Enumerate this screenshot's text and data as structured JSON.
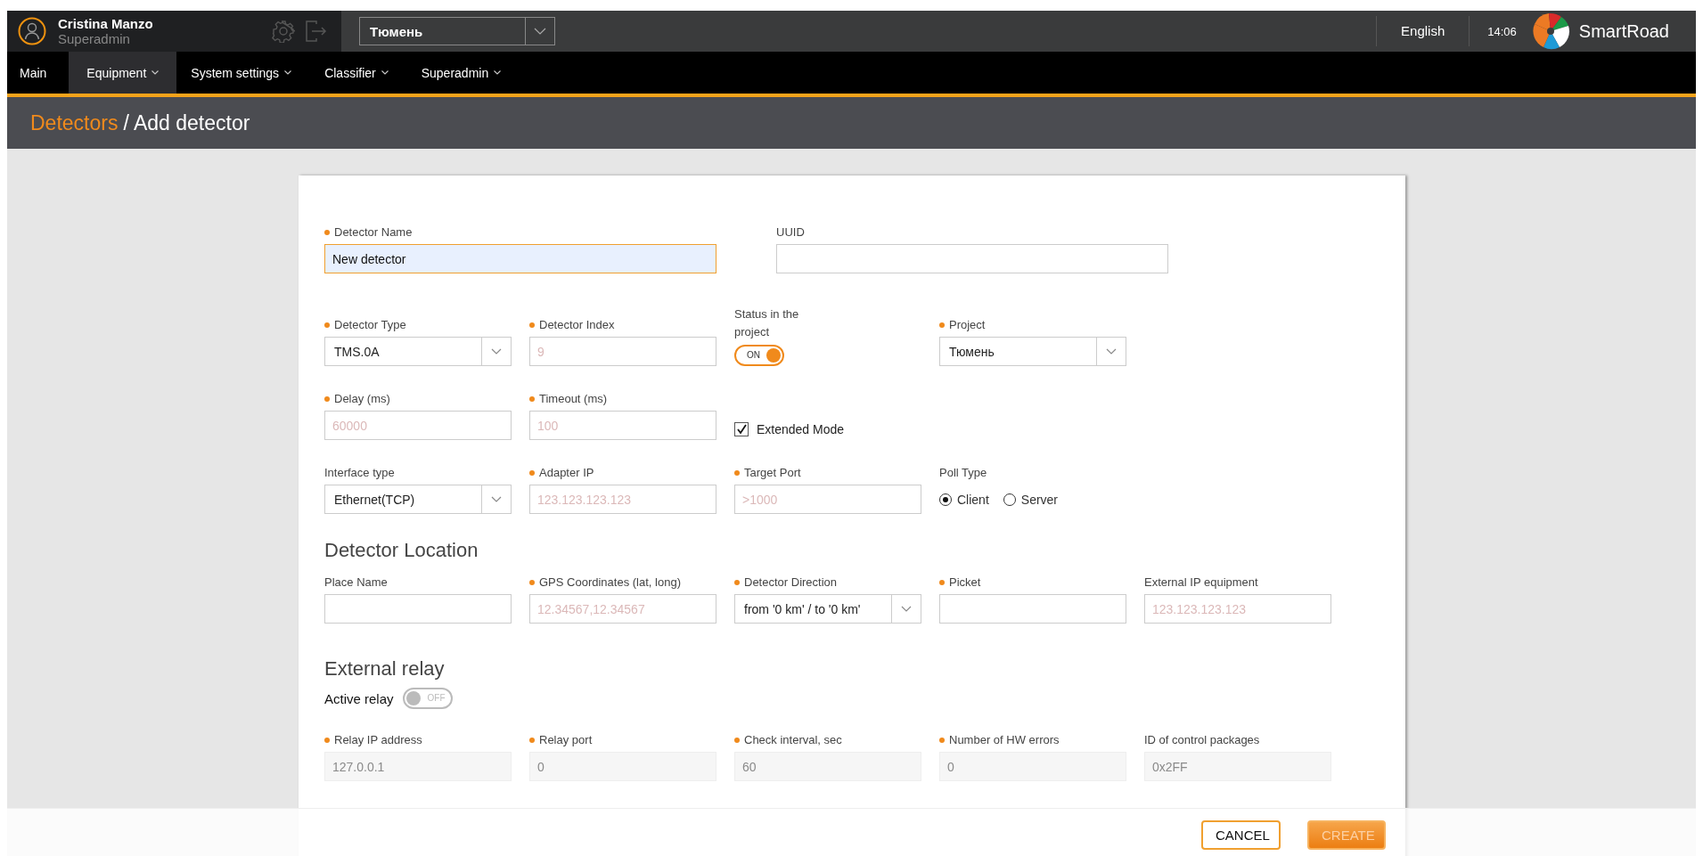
{
  "user": {
    "name": "Cristina Manzo",
    "role": "Superadmin"
  },
  "project_select": {
    "value": "Тюмень"
  },
  "language": "English",
  "time": "14:06",
  "brand": "SmartRoad",
  "nav": [
    {
      "label": "Main",
      "selected": false,
      "dropdown": false
    },
    {
      "label": "Equipment",
      "selected": true,
      "dropdown": true
    },
    {
      "label": "System settings",
      "selected": false,
      "dropdown": true
    },
    {
      "label": "Classifier",
      "selected": false,
      "dropdown": true
    },
    {
      "label": "Superadmin",
      "selected": false,
      "dropdown": true
    }
  ],
  "breadcrumb": {
    "parent": "Detectors",
    "current": "/ Add detector"
  },
  "name_row": [
    {
      "kind": "text",
      "label": "Detector Name",
      "required": true,
      "value": "New detector",
      "disabled": false
    },
    {
      "kind": "text",
      "label": "UUID",
      "required": false,
      "disabled": false
    }
  ],
  "rows": [
    [
      {
        "kind": "select",
        "label": "Detector Type",
        "required": true,
        "value": "TMS.0A"
      },
      {
        "kind": "text",
        "label": "Detector Index",
        "required": true,
        "placeholder": "9",
        "disabled": false
      },
      {
        "kind": "toggle",
        "label": "Status in the project",
        "on": true,
        "text": "ON"
      },
      {
        "kind": "select",
        "label": "Project",
        "required": true,
        "value": "Тюмень"
      }
    ],
    [
      {
        "kind": "text",
        "label": "Delay (ms)",
        "required": true,
        "placeholder": "60000",
        "disabled": false
      },
      {
        "kind": "text",
        "label": "Timeout (ms)",
        "required": true,
        "placeholder": "100",
        "disabled": false
      },
      {
        "kind": "checkbox",
        "text": "Extended Mode",
        "checked": true
      }
    ],
    [
      {
        "kind": "select",
        "label": "Interface type",
        "required": false,
        "value": "Ethernet(TCP)"
      },
      {
        "kind": "text",
        "label": "Adapter IP",
        "required": true,
        "placeholder": "123.123.123.123",
        "disabled": false
      },
      {
        "kind": "text",
        "label": "Target Port",
        "required": true,
        "placeholder": ">1000",
        "disabled": false
      },
      {
        "kind": "radio",
        "label": "Poll Type",
        "options": [
          {
            "text": "Client",
            "selected": true
          },
          {
            "text": "Server",
            "selected": false
          }
        ]
      }
    ]
  ],
  "location": {
    "title": "Detector Location",
    "fields": [
      {
        "kind": "text",
        "label": "Place Name",
        "required": false,
        "disabled": false
      },
      {
        "kind": "text",
        "label": "GPS Coordinates (lat, long)",
        "required": true,
        "placeholder": "12.34567,12.34567",
        "disabled": false
      },
      {
        "kind": "select",
        "label": "Detector Direction",
        "required": true,
        "value": "from '0 km' / to '0 km'"
      },
      {
        "kind": "text",
        "label": "Picket",
        "required": true,
        "disabled": false
      },
      {
        "kind": "text",
        "label": "External IP equipment",
        "required": false,
        "placeholder": "123.123.123.123",
        "disabled": false
      }
    ]
  },
  "relay": {
    "title": "External relay",
    "active_label": "Active relay",
    "active": false,
    "active_text": "OFF",
    "fields": [
      {
        "kind": "text",
        "label": "Relay IP address",
        "required": true,
        "placeholder": "127.0.0.1",
        "disabled": true
      },
      {
        "kind": "text",
        "label": "Relay port",
        "required": true,
        "placeholder": "0",
        "disabled": true
      },
      {
        "kind": "text",
        "label": "Check interval, sec",
        "required": true,
        "placeholder": "60",
        "disabled": true
      },
      {
        "kind": "text",
        "label": "Number of HW errors",
        "required": true,
        "placeholder": "0",
        "disabled": true
      },
      {
        "kind": "text",
        "label": "ID of control packages",
        "required": false,
        "placeholder": "0x2FF",
        "disabled": true
      }
    ]
  },
  "buttons": [
    {
      "kind": "cancel",
      "label": "CANCEL",
      "disabled": false
    },
    {
      "kind": "create",
      "label": "CREATE",
      "disabled": true
    }
  ]
}
